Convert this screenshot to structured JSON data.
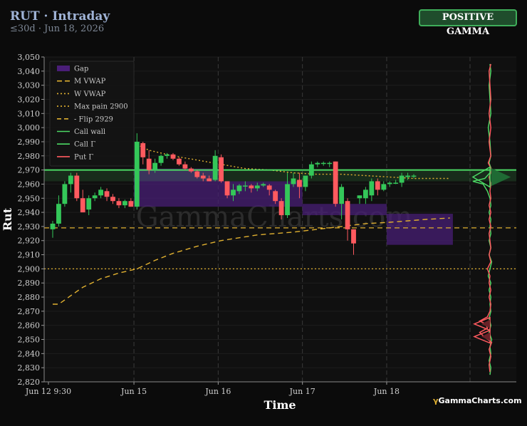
{
  "header": {
    "title": "RUT · Intraday",
    "subtitle": "≤30d · Jun 18, 2026",
    "badge": "POSITIVE GAMMA"
  },
  "watermark": "GammaCharts.com",
  "brand": {
    "mark": "γ",
    "text": "GammaCharts.com"
  },
  "colors": {
    "up": "#34c759",
    "down": "#ff5a5f",
    "gap": "#4a1e78",
    "vwap": "#e0b030",
    "call": "#4cd964",
    "put": "#ff5a5f",
    "badge_bg": "#1f4d2c"
  },
  "chart_data": {
    "type": "candlestick",
    "xlabel": "Time",
    "ylabel": "Rut",
    "ylim": [
      2820,
      3050
    ],
    "yticks": [
      2820,
      2830,
      2840,
      2850,
      2860,
      2870,
      2880,
      2890,
      2900,
      2910,
      2920,
      2930,
      2940,
      2950,
      2960,
      2970,
      2980,
      2990,
      3000,
      3010,
      3020,
      3030,
      3040,
      3050
    ],
    "xticks": [
      {
        "label": "Jun 12 9:30",
        "i": 0
      },
      {
        "label": "Jun 15",
        "i": 14
      },
      {
        "label": "Jun 16",
        "i": 28
      },
      {
        "label": "Jun 17",
        "i": 42
      },
      {
        "label": "Jun 18",
        "i": 56
      }
    ],
    "candles": [
      [
        2928,
        2934,
        2922,
        2932
      ],
      [
        2932,
        2952,
        2930,
        2946
      ],
      [
        2946,
        2962,
        2944,
        2960
      ],
      [
        2960,
        2968,
        2954,
        2966
      ],
      [
        2966,
        2968,
        2948,
        2950
      ],
      [
        2950,
        2956,
        2940,
        2940
      ],
      [
        2942,
        2952,
        2938,
        2950
      ],
      [
        2950,
        2954,
        2948,
        2952
      ],
      [
        2952,
        2958,
        2950,
        2956
      ],
      [
        2955,
        2957,
        2948,
        2951
      ],
      [
        2951,
        2953,
        2946,
        2948
      ],
      [
        2948,
        2950,
        2943,
        2945
      ],
      [
        2945,
        2949,
        2943,
        2948
      ],
      [
        2948,
        2950,
        2944,
        2944
      ],
      [
        2944,
        2996,
        2942,
        2990
      ],
      [
        2989,
        2990,
        2974,
        2979
      ],
      [
        2978,
        2984,
        2967,
        2970
      ],
      [
        2970,
        2978,
        2968,
        2975
      ],
      [
        2975,
        2981,
        2973,
        2980
      ],
      [
        2980,
        2982,
        2978,
        2981
      ],
      [
        2981,
        2982,
        2977,
        2978
      ],
      [
        2978,
        2979,
        2973,
        2974
      ],
      [
        2974,
        2976,
        2970,
        2971
      ],
      [
        2971,
        2972,
        2968,
        2969
      ],
      [
        2969,
        2970,
        2964,
        2965
      ],
      [
        2966,
        2968,
        2962,
        2964
      ],
      [
        2964,
        2966,
        2962,
        2962
      ],
      [
        2963,
        2984,
        2962,
        2980
      ],
      [
        2979,
        2981,
        2961,
        2962
      ],
      [
        2962,
        2962,
        2950,
        2952
      ],
      [
        2952,
        2960,
        2948,
        2956
      ],
      [
        2955,
        2960,
        2953,
        2959
      ],
      [
        2959,
        2962,
        2955,
        2959
      ],
      [
        2959,
        2960,
        2954,
        2957
      ],
      [
        2957,
        2961,
        2955,
        2959
      ],
      [
        2959,
        2961,
        2958,
        2960
      ],
      [
        2959,
        2960,
        2952,
        2956
      ],
      [
        2955,
        2956,
        2946,
        2948
      ],
      [
        2948,
        2950,
        2935,
        2938
      ],
      [
        2938,
        2968,
        2936,
        2960
      ],
      [
        2960,
        2968,
        2958,
        2964
      ],
      [
        2963,
        2968,
        2950,
        2958
      ],
      [
        2958,
        2966,
        2955,
        2966
      ],
      [
        2966,
        2976,
        2964,
        2974
      ],
      [
        2974,
        2976,
        2972,
        2975
      ],
      [
        2975,
        2976,
        2973,
        2975
      ],
      [
        2975,
        2976,
        2972,
        2975
      ],
      [
        2976,
        2976,
        2944,
        2946
      ],
      [
        2946,
        2960,
        2935,
        2958
      ],
      [
        2948,
        2950,
        2920,
        2928
      ],
      [
        2928,
        2928,
        2910,
        2918
      ],
      [
        2950,
        2952,
        2946,
        2952
      ],
      [
        2950,
        2958,
        2946,
        2956
      ],
      [
        2952,
        2964,
        2948,
        2962
      ],
      [
        2962,
        2964,
        2952,
        2956
      ],
      [
        2956,
        2962,
        2955,
        2960
      ],
      [
        2960,
        2962,
        2958,
        2961
      ],
      [
        2961,
        2963,
        2960,
        2961
      ],
      [
        2961,
        2968,
        2958,
        2966
      ],
      [
        2965,
        2968,
        2963,
        2966
      ],
      [
        2966,
        2967,
        2964,
        2966
      ]
    ],
    "gaps": [
      {
        "i0": 14,
        "i1": 28,
        "y0": 2944,
        "y1": 2971
      },
      {
        "i0": 28,
        "i1": 42,
        "y0": 2944,
        "y1": 2962
      },
      {
        "i0": 42,
        "i1": 56,
        "y0": 2938,
        "y1": 2946
      },
      {
        "i0": 56,
        "i1": 67,
        "y0": 2917,
        "y1": 2939
      }
    ],
    "series": [
      {
        "name": "Gap",
        "style": "gap"
      },
      {
        "name": "M VWAP",
        "style": "dashed",
        "color": "#e0b030",
        "points": [
          [
            0,
            2875
          ],
          [
            1,
            2875
          ],
          [
            3,
            2881
          ],
          [
            5,
            2887
          ],
          [
            8,
            2893
          ],
          [
            11,
            2897
          ],
          [
            14,
            2900
          ],
          [
            17,
            2906
          ],
          [
            20,
            2911
          ],
          [
            24,
            2916
          ],
          [
            28,
            2920
          ],
          [
            34,
            2924
          ],
          [
            40,
            2926
          ],
          [
            46,
            2929
          ],
          [
            52,
            2932
          ],
          [
            56,
            2933
          ],
          [
            62,
            2935
          ],
          [
            66,
            2936
          ]
        ]
      },
      {
        "name": "W VWAP",
        "style": "dotted",
        "color": "#e0b030",
        "points": [
          [
            14,
            2988
          ],
          [
            16,
            2984
          ],
          [
            20,
            2980
          ],
          [
            24,
            2977
          ],
          [
            28,
            2974
          ],
          [
            32,
            2971
          ],
          [
            36,
            2970
          ],
          [
            40,
            2968
          ],
          [
            44,
            2967
          ],
          [
            48,
            2967
          ],
          [
            52,
            2966
          ],
          [
            56,
            2965
          ],
          [
            60,
            2964
          ],
          [
            66,
            2964
          ]
        ]
      },
      {
        "name": "Max pain 2900",
        "style": "hline-dotted",
        "color": "#e0b030",
        "value": 2900
      },
      {
        "name": "- Flip 2929",
        "style": "hline-dashed",
        "color": "#e0b030",
        "value": 2929
      },
      {
        "name": "Call wall",
        "style": "hline",
        "color": "#4cd964",
        "value": 2970
      },
      {
        "name": "Call Γ",
        "style": "band",
        "color": "#4cd964",
        "range": [
          2962,
          2970
        ]
      },
      {
        "name": "Put Γ",
        "style": "profile",
        "color": "#ff5a5f"
      }
    ],
    "gamma_profile": {
      "call_points": [
        [
          2825,
          0
        ],
        [
          2830,
          1
        ],
        [
          2835,
          -1
        ],
        [
          2840,
          1
        ],
        [
          2845,
          0
        ],
        [
          2850,
          2
        ],
        [
          2855,
          -1
        ],
        [
          2860,
          1
        ],
        [
          2865,
          -1
        ],
        [
          2870,
          1
        ],
        [
          2875,
          0
        ],
        [
          2880,
          1
        ],
        [
          2885,
          -1
        ],
        [
          2890,
          1
        ],
        [
          2895,
          -2
        ],
        [
          2900,
          0
        ],
        [
          2905,
          2
        ],
        [
          2910,
          -1
        ],
        [
          2915,
          1
        ],
        [
          2920,
          -1
        ],
        [
          2925,
          1
        ],
        [
          2930,
          0
        ],
        [
          2935,
          1
        ],
        [
          2940,
          -1
        ],
        [
          2945,
          1
        ],
        [
          2950,
          0
        ],
        [
          2955,
          -3
        ],
        [
          2960,
          -8
        ],
        [
          2962,
          -20
        ],
        [
          2964,
          -6
        ],
        [
          2966,
          -3
        ],
        [
          2968,
          0
        ],
        [
          2970,
          2
        ],
        [
          2975,
          -1
        ],
        [
          2980,
          1
        ],
        [
          2990,
          0
        ],
        [
          3000,
          -2
        ],
        [
          3010,
          1
        ],
        [
          3020,
          0
        ],
        [
          3030,
          -1
        ],
        [
          3040,
          1
        ],
        [
          3045,
          0
        ]
      ],
      "put_points": [
        [
          2827,
          0
        ],
        [
          2832,
          -1
        ],
        [
          2838,
          1
        ],
        [
          2843,
          -1
        ],
        [
          2848,
          2
        ],
        [
          2852,
          -7
        ],
        [
          2855,
          -12
        ],
        [
          2858,
          -3
        ],
        [
          2861,
          -5
        ],
        [
          2863,
          -12
        ],
        [
          2866,
          -3
        ],
        [
          2870,
          0
        ],
        [
          2875,
          1
        ],
        [
          2880,
          -1
        ],
        [
          2885,
          1
        ],
        [
          2890,
          -1
        ],
        [
          2895,
          0
        ],
        [
          2900,
          -3
        ],
        [
          2905,
          1
        ],
        [
          2910,
          -1
        ],
        [
          2915,
          1
        ],
        [
          2920,
          0
        ],
        [
          2925,
          -1
        ],
        [
          2930,
          1
        ],
        [
          2935,
          -1
        ],
        [
          2940,
          1
        ],
        [
          2945,
          -1
        ],
        [
          2950,
          1
        ],
        [
          2955,
          0
        ],
        [
          2960,
          1
        ],
        [
          2965,
          -1
        ],
        [
          2970,
          2
        ],
        [
          2975,
          -2
        ],
        [
          2980,
          1
        ],
        [
          2990,
          -1
        ],
        [
          3000,
          1
        ],
        [
          3010,
          -1
        ],
        [
          3020,
          1
        ],
        [
          3030,
          0
        ],
        [
          3040,
          -1
        ],
        [
          3045,
          1
        ]
      ],
      "call_peak": 2965,
      "put_peaks": [
        2852,
        2861
      ]
    }
  }
}
